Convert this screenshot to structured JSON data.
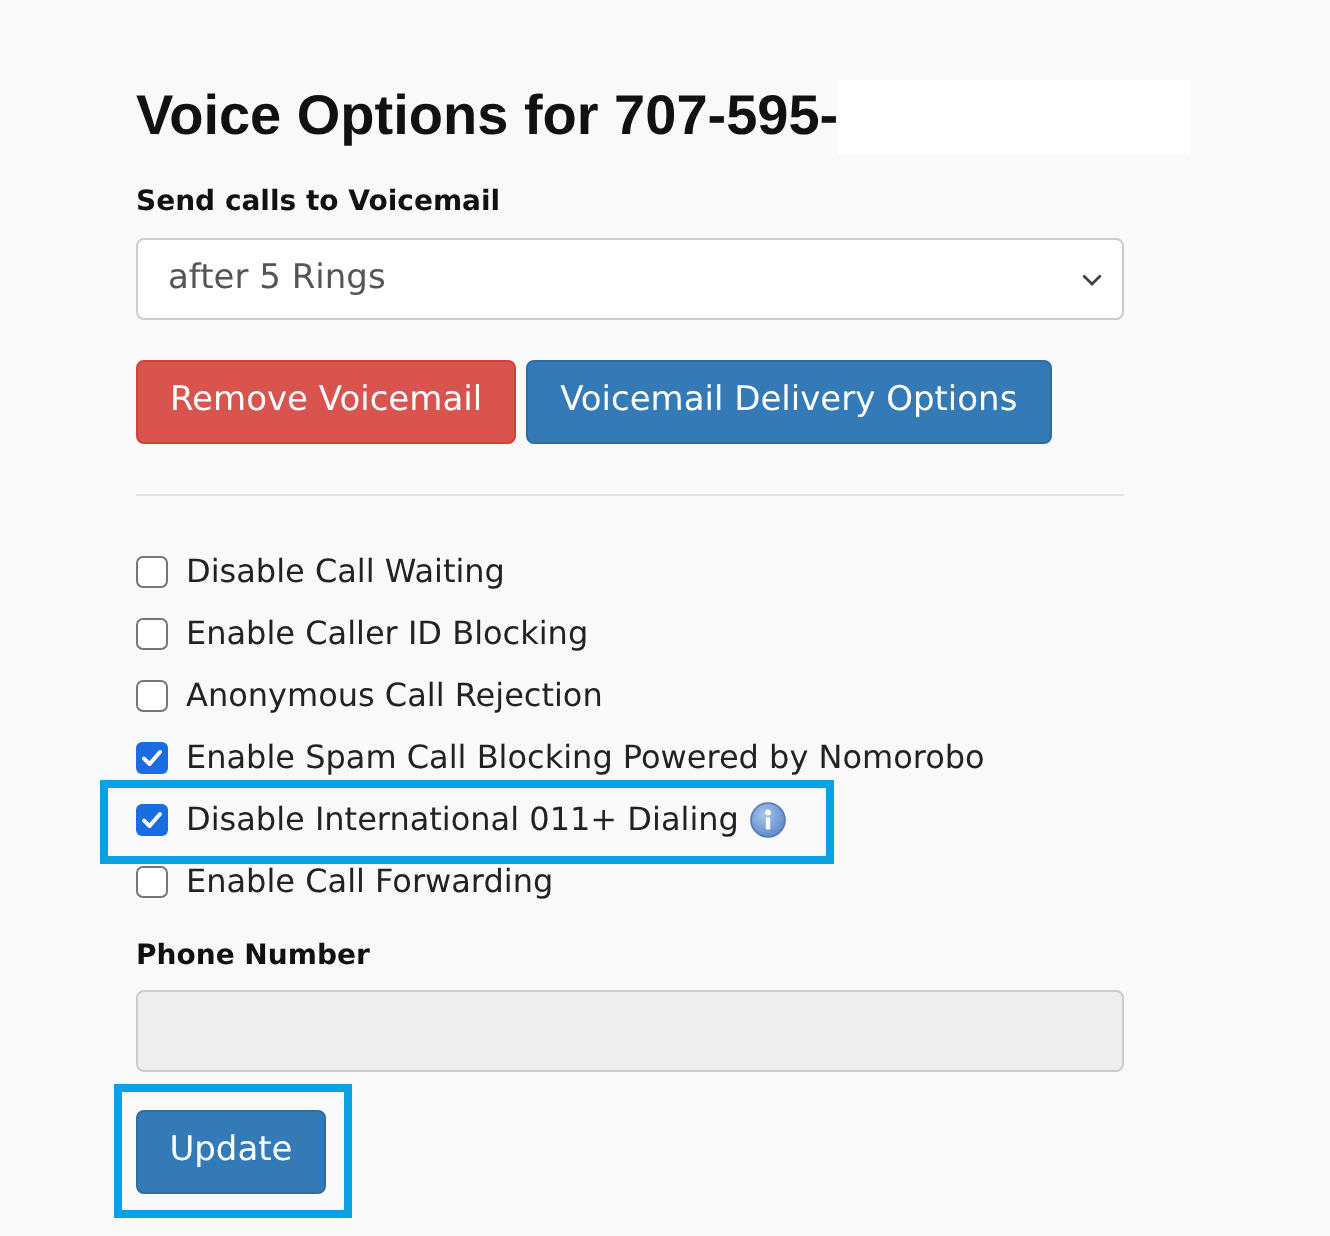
{
  "title": {
    "text": "Voice Options for 707-595-",
    "redacted": true
  },
  "voicemail": {
    "label": "Send calls to Voicemail",
    "value": "after 5 Rings"
  },
  "buttons": [
    {
      "label": "Remove Voicemail",
      "kind": "danger"
    },
    {
      "label": "Voicemail Delivery Options",
      "kind": "primary"
    }
  ],
  "options": [
    {
      "label": "Disable Call Waiting",
      "checked": false,
      "highlighted": false,
      "info": false
    },
    {
      "label": "Enable Caller ID Blocking",
      "checked": false,
      "highlighted": false,
      "info": false
    },
    {
      "label": "Anonymous Call Rejection",
      "checked": false,
      "highlighted": false,
      "info": false
    },
    {
      "label": "Enable Spam Call Blocking Powered by Nomorobo",
      "checked": true,
      "highlighted": false,
      "info": false
    },
    {
      "label": "Disable International 011+ Dialing",
      "checked": true,
      "highlighted": true,
      "info": true
    },
    {
      "label": "Enable Call Forwarding",
      "checked": false,
      "highlighted": false,
      "info": false
    }
  ],
  "phone_number": {
    "label": "Phone Number",
    "disabled": true
  },
  "update_button": {
    "label": "Update",
    "highlighted": true
  }
}
